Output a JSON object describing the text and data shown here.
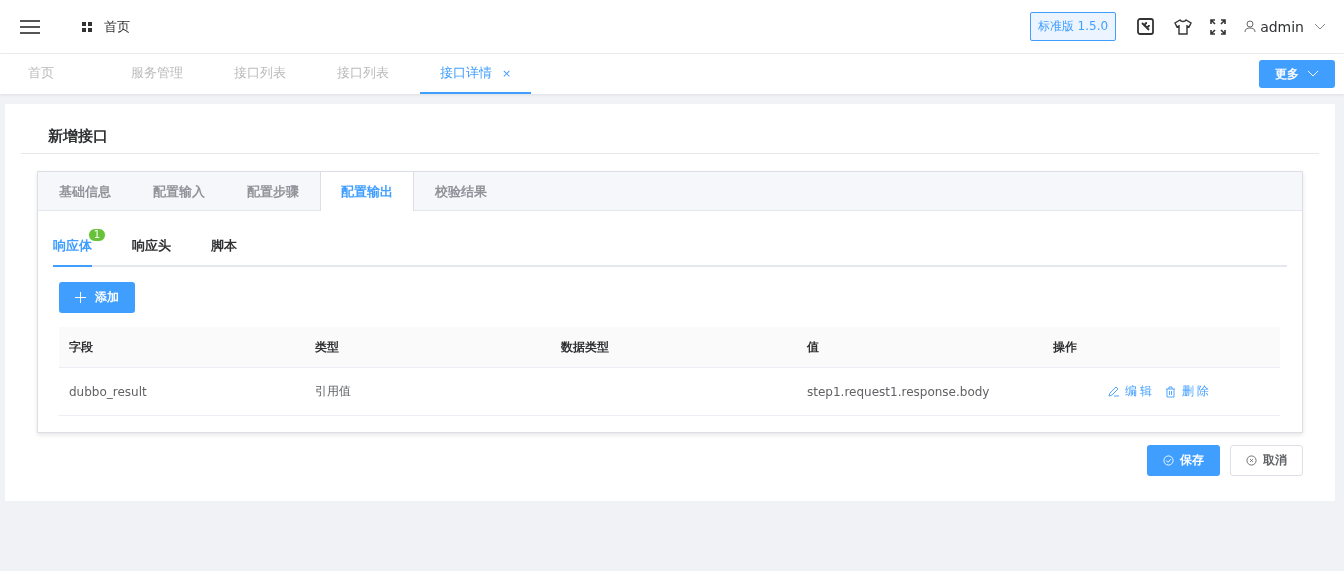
{
  "header": {
    "breadcrumb": "首页",
    "version": "标准版 1.5.0",
    "user": "admin"
  },
  "tags": [
    {
      "label": "首页",
      "selected": false,
      "closable": false
    },
    {
      "label": "服务管理",
      "selected": false,
      "closable": false
    },
    {
      "label": "接口列表",
      "selected": false,
      "closable": false
    },
    {
      "label": "接口列表",
      "selected": false,
      "closable": false
    },
    {
      "label": "接口详情",
      "selected": true,
      "closable": true
    }
  ],
  "tag_close": "×",
  "more_button": "更多",
  "page_title": "新增接口",
  "tabs": [
    {
      "label": "基础信息",
      "selected": false
    },
    {
      "label": "配置输入",
      "selected": false
    },
    {
      "label": "配置步骤",
      "selected": false
    },
    {
      "label": "配置输出",
      "selected": true
    },
    {
      "label": "校验结果",
      "selected": false
    }
  ],
  "subtabs": [
    {
      "label": "响应体",
      "selected": true,
      "badge": "1"
    },
    {
      "label": "响应头",
      "selected": false
    },
    {
      "label": "脚本",
      "selected": false
    }
  ],
  "add_button": "添加",
  "table": {
    "columns": [
      "字段",
      "类型",
      "数据类型",
      "值",
      "操作"
    ],
    "rows": [
      {
        "cells": [
          "dubbo_result",
          "引用值",
          "",
          "step1.request1.response.body"
        ],
        "actions": [
          "编 辑",
          "删 除"
        ]
      }
    ]
  },
  "footer_buttons": [
    {
      "label": "保存",
      "kind": "primary"
    },
    {
      "label": "取消",
      "kind": "default"
    }
  ]
}
